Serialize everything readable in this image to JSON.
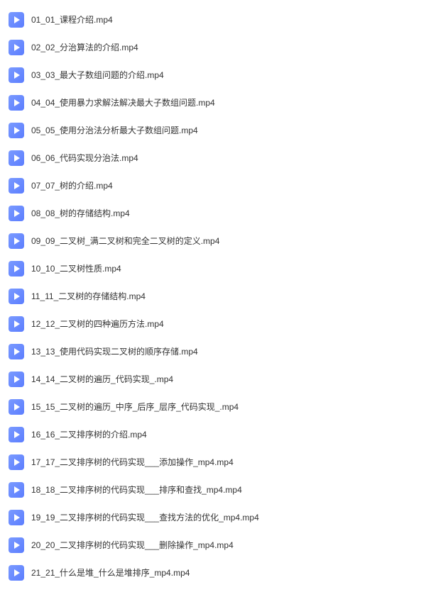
{
  "files": [
    {
      "name": "01_01_课程介绍.mp4"
    },
    {
      "name": "02_02_分治算法的介绍.mp4"
    },
    {
      "name": "03_03_最大子数组问题的介绍.mp4"
    },
    {
      "name": "04_04_使用暴力求解法解决最大子数组问题.mp4"
    },
    {
      "name": "05_05_使用分治法分析最大子数组问题.mp4"
    },
    {
      "name": "06_06_代码实现分治法.mp4"
    },
    {
      "name": "07_07_树的介绍.mp4"
    },
    {
      "name": "08_08_树的存储结构.mp4"
    },
    {
      "name": "09_09_二叉树_满二叉树和完全二叉树的定义.mp4"
    },
    {
      "name": "10_10_二叉树性质.mp4"
    },
    {
      "name": "11_11_二叉树的存储结构.mp4"
    },
    {
      "name": "12_12_二叉树的四种遍历方法.mp4"
    },
    {
      "name": "13_13_使用代码实现二叉树的顺序存储.mp4"
    },
    {
      "name": "14_14_二叉树的遍历_代码实现_.mp4"
    },
    {
      "name": "15_15_二叉树的遍历_中序_后序_层序_代码实现_.mp4"
    },
    {
      "name": "16_16_二叉排序树的介绍.mp4"
    },
    {
      "name": "17_17_二叉排序树的代码实现___添加操作_mp4.mp4"
    },
    {
      "name": "18_18_二叉排序树的代码实现___排序和查找_mp4.mp4"
    },
    {
      "name": "19_19_二叉排序树的代码实现___查找方法的优化_mp4.mp4"
    },
    {
      "name": "20_20_二叉排序树的代码实现___删除操作_mp4.mp4"
    },
    {
      "name": "21_21_什么是堆_什么是堆排序_mp4.mp4"
    }
  ]
}
